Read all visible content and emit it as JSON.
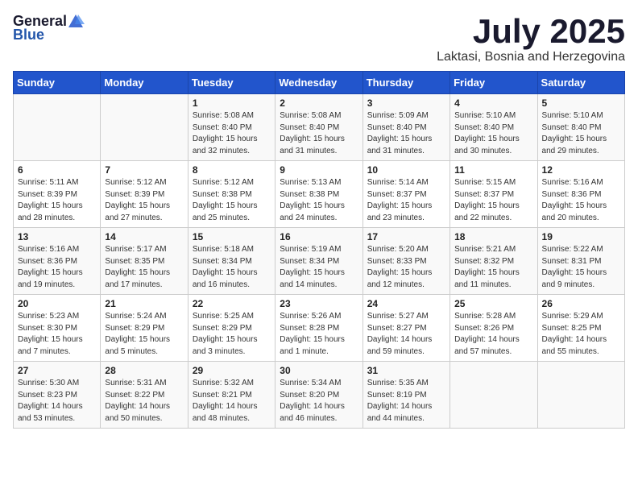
{
  "logo": {
    "general": "General",
    "blue": "Blue"
  },
  "title": "July 2025",
  "location": "Laktasi, Bosnia and Herzegovina",
  "days_of_week": [
    "Sunday",
    "Monday",
    "Tuesday",
    "Wednesday",
    "Thursday",
    "Friday",
    "Saturday"
  ],
  "weeks": [
    [
      {
        "day": "",
        "sunrise": "",
        "sunset": "",
        "daylight": ""
      },
      {
        "day": "",
        "sunrise": "",
        "sunset": "",
        "daylight": ""
      },
      {
        "day": "1",
        "sunrise": "Sunrise: 5:08 AM",
        "sunset": "Sunset: 8:40 PM",
        "daylight": "Daylight: 15 hours and 32 minutes."
      },
      {
        "day": "2",
        "sunrise": "Sunrise: 5:08 AM",
        "sunset": "Sunset: 8:40 PM",
        "daylight": "Daylight: 15 hours and 31 minutes."
      },
      {
        "day": "3",
        "sunrise": "Sunrise: 5:09 AM",
        "sunset": "Sunset: 8:40 PM",
        "daylight": "Daylight: 15 hours and 31 minutes."
      },
      {
        "day": "4",
        "sunrise": "Sunrise: 5:10 AM",
        "sunset": "Sunset: 8:40 PM",
        "daylight": "Daylight: 15 hours and 30 minutes."
      },
      {
        "day": "5",
        "sunrise": "Sunrise: 5:10 AM",
        "sunset": "Sunset: 8:40 PM",
        "daylight": "Daylight: 15 hours and 29 minutes."
      }
    ],
    [
      {
        "day": "6",
        "sunrise": "Sunrise: 5:11 AM",
        "sunset": "Sunset: 8:39 PM",
        "daylight": "Daylight: 15 hours and 28 minutes."
      },
      {
        "day": "7",
        "sunrise": "Sunrise: 5:12 AM",
        "sunset": "Sunset: 8:39 PM",
        "daylight": "Daylight: 15 hours and 27 minutes."
      },
      {
        "day": "8",
        "sunrise": "Sunrise: 5:12 AM",
        "sunset": "Sunset: 8:38 PM",
        "daylight": "Daylight: 15 hours and 25 minutes."
      },
      {
        "day": "9",
        "sunrise": "Sunrise: 5:13 AM",
        "sunset": "Sunset: 8:38 PM",
        "daylight": "Daylight: 15 hours and 24 minutes."
      },
      {
        "day": "10",
        "sunrise": "Sunrise: 5:14 AM",
        "sunset": "Sunset: 8:37 PM",
        "daylight": "Daylight: 15 hours and 23 minutes."
      },
      {
        "day": "11",
        "sunrise": "Sunrise: 5:15 AM",
        "sunset": "Sunset: 8:37 PM",
        "daylight": "Daylight: 15 hours and 22 minutes."
      },
      {
        "day": "12",
        "sunrise": "Sunrise: 5:16 AM",
        "sunset": "Sunset: 8:36 PM",
        "daylight": "Daylight: 15 hours and 20 minutes."
      }
    ],
    [
      {
        "day": "13",
        "sunrise": "Sunrise: 5:16 AM",
        "sunset": "Sunset: 8:36 PM",
        "daylight": "Daylight: 15 hours and 19 minutes."
      },
      {
        "day": "14",
        "sunrise": "Sunrise: 5:17 AM",
        "sunset": "Sunset: 8:35 PM",
        "daylight": "Daylight: 15 hours and 17 minutes."
      },
      {
        "day": "15",
        "sunrise": "Sunrise: 5:18 AM",
        "sunset": "Sunset: 8:34 PM",
        "daylight": "Daylight: 15 hours and 16 minutes."
      },
      {
        "day": "16",
        "sunrise": "Sunrise: 5:19 AM",
        "sunset": "Sunset: 8:34 PM",
        "daylight": "Daylight: 15 hours and 14 minutes."
      },
      {
        "day": "17",
        "sunrise": "Sunrise: 5:20 AM",
        "sunset": "Sunset: 8:33 PM",
        "daylight": "Daylight: 15 hours and 12 minutes."
      },
      {
        "day": "18",
        "sunrise": "Sunrise: 5:21 AM",
        "sunset": "Sunset: 8:32 PM",
        "daylight": "Daylight: 15 hours and 11 minutes."
      },
      {
        "day": "19",
        "sunrise": "Sunrise: 5:22 AM",
        "sunset": "Sunset: 8:31 PM",
        "daylight": "Daylight: 15 hours and 9 minutes."
      }
    ],
    [
      {
        "day": "20",
        "sunrise": "Sunrise: 5:23 AM",
        "sunset": "Sunset: 8:30 PM",
        "daylight": "Daylight: 15 hours and 7 minutes."
      },
      {
        "day": "21",
        "sunrise": "Sunrise: 5:24 AM",
        "sunset": "Sunset: 8:29 PM",
        "daylight": "Daylight: 15 hours and 5 minutes."
      },
      {
        "day": "22",
        "sunrise": "Sunrise: 5:25 AM",
        "sunset": "Sunset: 8:29 PM",
        "daylight": "Daylight: 15 hours and 3 minutes."
      },
      {
        "day": "23",
        "sunrise": "Sunrise: 5:26 AM",
        "sunset": "Sunset: 8:28 PM",
        "daylight": "Daylight: 15 hours and 1 minute."
      },
      {
        "day": "24",
        "sunrise": "Sunrise: 5:27 AM",
        "sunset": "Sunset: 8:27 PM",
        "daylight": "Daylight: 14 hours and 59 minutes."
      },
      {
        "day": "25",
        "sunrise": "Sunrise: 5:28 AM",
        "sunset": "Sunset: 8:26 PM",
        "daylight": "Daylight: 14 hours and 57 minutes."
      },
      {
        "day": "26",
        "sunrise": "Sunrise: 5:29 AM",
        "sunset": "Sunset: 8:25 PM",
        "daylight": "Daylight: 14 hours and 55 minutes."
      }
    ],
    [
      {
        "day": "27",
        "sunrise": "Sunrise: 5:30 AM",
        "sunset": "Sunset: 8:23 PM",
        "daylight": "Daylight: 14 hours and 53 minutes."
      },
      {
        "day": "28",
        "sunrise": "Sunrise: 5:31 AM",
        "sunset": "Sunset: 8:22 PM",
        "daylight": "Daylight: 14 hours and 50 minutes."
      },
      {
        "day": "29",
        "sunrise": "Sunrise: 5:32 AM",
        "sunset": "Sunset: 8:21 PM",
        "daylight": "Daylight: 14 hours and 48 minutes."
      },
      {
        "day": "30",
        "sunrise": "Sunrise: 5:34 AM",
        "sunset": "Sunset: 8:20 PM",
        "daylight": "Daylight: 14 hours and 46 minutes."
      },
      {
        "day": "31",
        "sunrise": "Sunrise: 5:35 AM",
        "sunset": "Sunset: 8:19 PM",
        "daylight": "Daylight: 14 hours and 44 minutes."
      },
      {
        "day": "",
        "sunrise": "",
        "sunset": "",
        "daylight": ""
      },
      {
        "day": "",
        "sunrise": "",
        "sunset": "",
        "daylight": ""
      }
    ]
  ]
}
